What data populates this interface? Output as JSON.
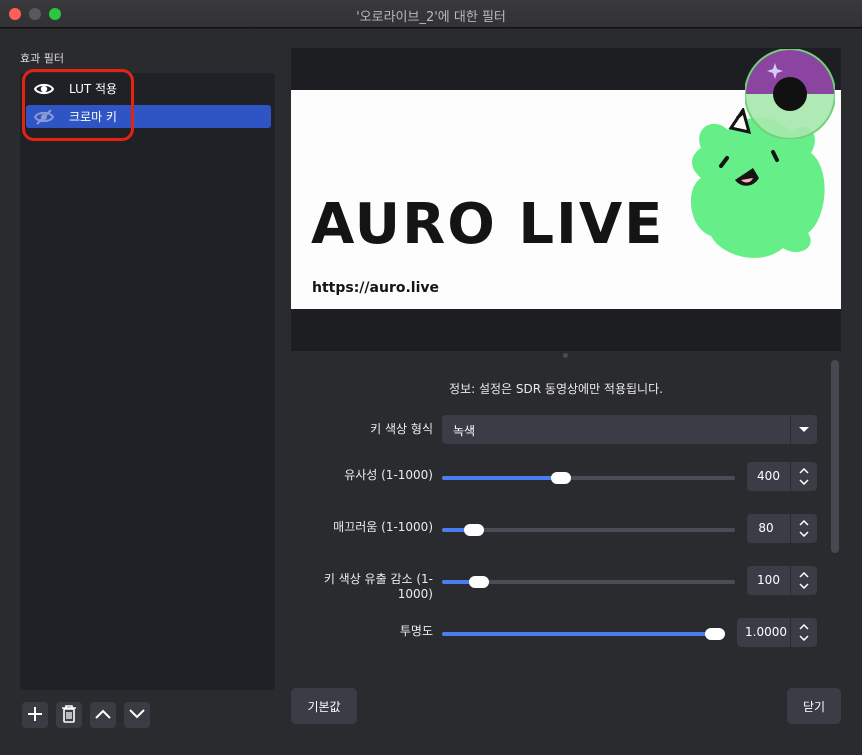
{
  "window": {
    "title": "'오로라이브_2'에 대한 필터"
  },
  "sidebar": {
    "title": "효과 필터",
    "items": [
      {
        "label": "LUT 적용",
        "visible": true,
        "selected": false
      },
      {
        "label": "크로마 키",
        "visible": false,
        "selected": true
      }
    ],
    "toolbar": {
      "add_icon": "plus-icon",
      "remove_icon": "trash-icon",
      "up_icon": "chevron-up-icon",
      "down_icon": "chevron-down-icon"
    }
  },
  "preview": {
    "logo_text": "AURO LIVE",
    "url_text": "https://auro.live",
    "mascot_color": "#66ee88"
  },
  "properties": {
    "info": "정보: 설정은 SDR 동영상에만 적용됩니다.",
    "key_color_type": {
      "label": "키 색상 형식",
      "value": "녹색"
    },
    "similarity": {
      "label": "유사성 (1-1000)",
      "value": "400",
      "level": 0.4
    },
    "smoothness": {
      "label": "매끄러움 (1-1000)",
      "value": "80",
      "level": 0.08
    },
    "spill_reduction": {
      "label": "키 색상 유출 감소 (1-1000)",
      "value": "100",
      "level": 0.1
    },
    "opacity": {
      "label": "투명도",
      "value": "1.0000",
      "level": 1.0
    }
  },
  "footer": {
    "defaults_label": "기본값",
    "close_label": "닫기"
  },
  "colors": {
    "accent": "#2f55c4",
    "slider_fill": "#4b7cf0",
    "highlight_ring": "#e42413"
  }
}
